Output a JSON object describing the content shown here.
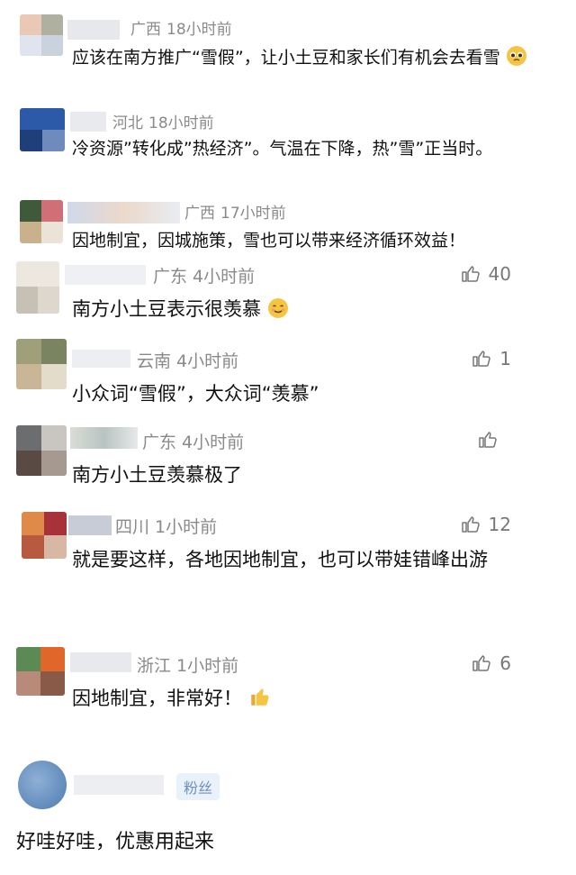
{
  "comments": [
    {
      "region": "广西",
      "time": "18小时前",
      "text": "应该在南方推广“雪假”，让小土豆和家长们有机会去看雪",
      "emoji": "pleading-face",
      "like": ""
    },
    {
      "region": "河北",
      "time": "18小时前",
      "text": "冷资源”转化成”热经济”。气温在下降，热”雪”正当时。",
      "emoji": "",
      "like": ""
    },
    {
      "region": "广西",
      "time": "17小时前",
      "text": "因地制宜，因城施策，雪也可以带来经济循环效益！",
      "emoji": "",
      "like": ""
    },
    {
      "region": "广东",
      "time": "4小时前",
      "text": "南方小土豆表示很羡慕",
      "emoji": "smiling-face",
      "like": "40"
    },
    {
      "region": "云南",
      "time": "4小时前",
      "text": "小众词“雪假”，大众词“羡慕”",
      "emoji": "",
      "like": "1"
    },
    {
      "region": "广东",
      "time": "4小时前",
      "text": "南方小土豆羡慕极了",
      "emoji": "",
      "like": ""
    },
    {
      "region": "四川",
      "time": "1小时前",
      "text": "就是要这样，各地因地制宜，也可以带娃错峰出游",
      "emoji": "",
      "like": "12"
    },
    {
      "region": "浙江",
      "time": "1小时前",
      "text": "因地制宜，非常好！",
      "emoji": "thumbs-up",
      "like": "6"
    }
  ],
  "last": {
    "badge": "粉丝",
    "text": "好哇好哇，优惠用起来"
  },
  "colors": {
    "meta": "#8a8a8a",
    "badge_bg": "#e9f1fb",
    "badge_text": "#6d8fbf"
  }
}
